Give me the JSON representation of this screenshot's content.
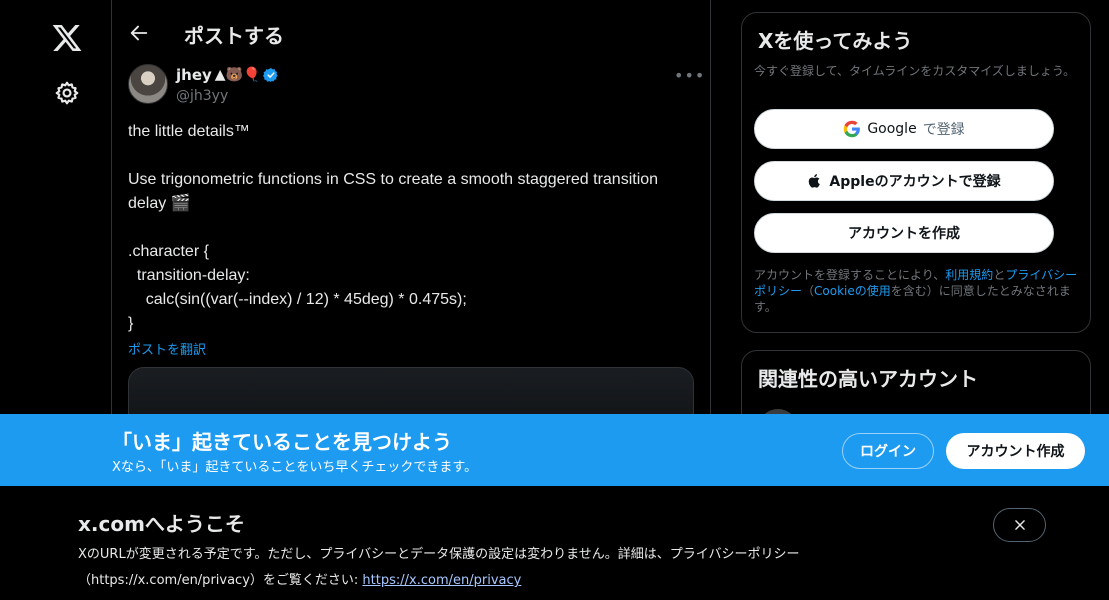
{
  "colors": {
    "accent": "#1d9bf0",
    "background": "#000000",
    "text": "#e7e9ea",
    "muted": "#71767b",
    "verified": "#1d9bf0"
  },
  "leftnav": {
    "logo_icon": "x-logo-icon",
    "settings_icon": "gear-icon"
  },
  "header": {
    "back_icon": "arrow-left-icon",
    "title": "ポストする"
  },
  "tweet": {
    "author_name": "jhey",
    "author_emojis": "▲🐻🎈",
    "handle": "@jh3yy",
    "more_icon": "more-horizontal-icon",
    "text": "the little details™\n\nUse trigonometric functions in CSS to create a smooth staggered transition delay 🎬\n\n.character {\n  transition-delay:\n    calc(sin((var(--index) / 12) * 45deg) * 0.475s);\n}",
    "translate_label": "ポストを翻訳"
  },
  "signup_box": {
    "title": "Xを使ってみよう",
    "subtitle": "今すぐ登録して、タイムラインをカスタマイズしましょう。",
    "google_label": "Google",
    "google_suffix": "で登録",
    "apple_label": "Appleのアカウントで登録",
    "create_label": "アカウントを作成",
    "terms_prefix": "アカウントを登録することにより、",
    "terms_link": "利用規約",
    "terms_and": "と",
    "privacy_link": "プライバシーポリシー",
    "terms_paren_open": "（",
    "cookie_link": "Cookieの使用",
    "terms_suffix": "を含む）に同意したとみなされます。"
  },
  "related": {
    "title": "関連性の高いアカウント"
  },
  "banner": {
    "title": "「いま」起きていることを見つけよう",
    "subtitle": "Xなら、「いま」起きていることをいち早くチェックできます。",
    "login_label": "ログイン",
    "signup_label": "アカウント作成"
  },
  "welcome": {
    "title": "x.comへようこそ",
    "body": "XのURLが変更される予定です。ただし、プライバシーとデータ保護の設定は変わりません。詳細は、プライバシーポリシー（https://x.com/en/privacy）をご覧ください: ",
    "link": "https://x.com/en/privacy",
    "close_icon": "close-icon"
  }
}
